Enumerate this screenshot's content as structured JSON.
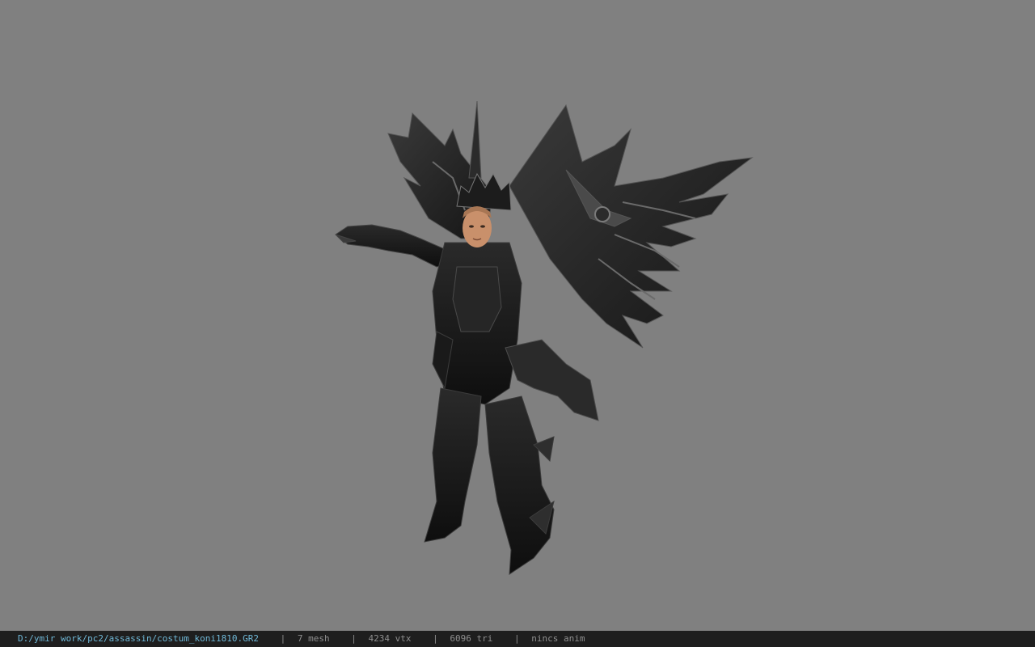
{
  "viewport": {
    "background_color": "#808080",
    "model_description": "dark armored winged character model"
  },
  "statusbar": {
    "file_path": "D:/ymir work/pc2/assassin/costum_koni1810.GR2",
    "separator": "|",
    "mesh_count": "7 mesh",
    "vertex_count": "4234 vtx",
    "triangle_count": "6096 tri",
    "anim_status": "nincs anim",
    "path_color": "#6fb7d6",
    "background_color": "#1e1e1e"
  }
}
